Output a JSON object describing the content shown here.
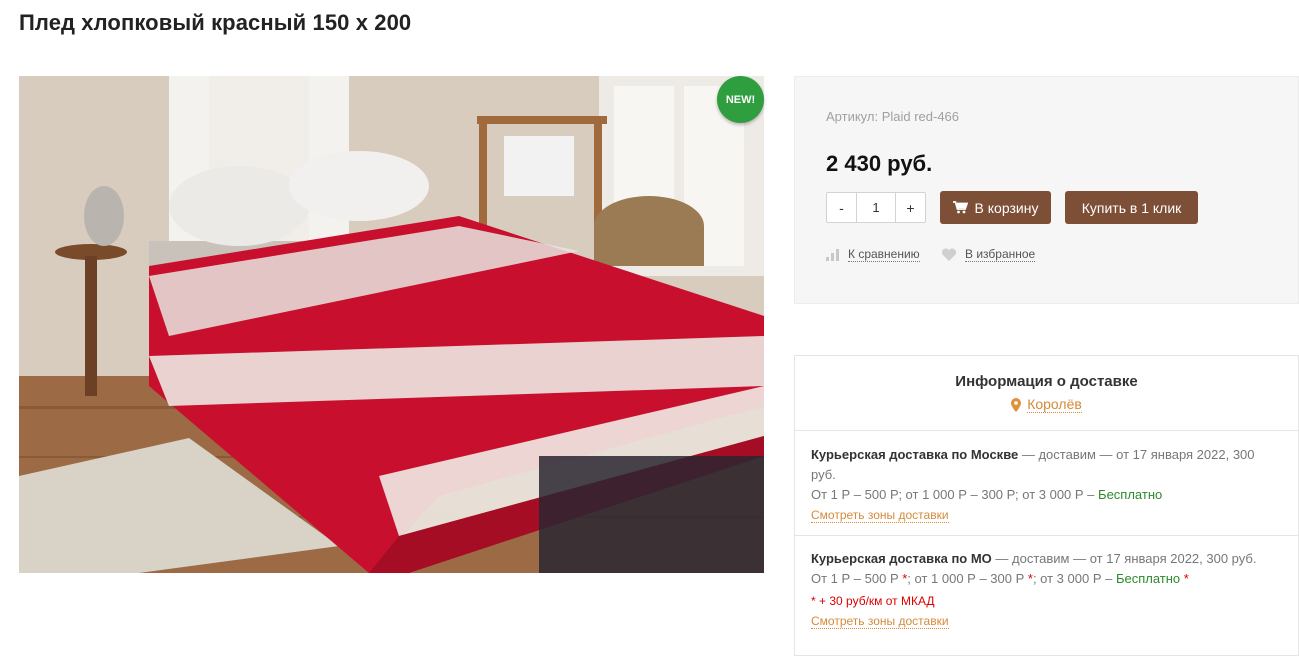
{
  "page": {
    "title": "Плед хлопковый красный 150 х 200"
  },
  "product": {
    "badge": "NEW!",
    "article": "Артикул: Plaid red-466",
    "price": "2 430 руб.",
    "quantity": "1",
    "qty_minus": "-",
    "qty_plus": "+",
    "cart_button": "В корзину",
    "one_click_button": "Купить в 1 клик",
    "compare_label": "К сравнению",
    "favorite_label": "В избранное"
  },
  "delivery": {
    "title": "Информация о доставке",
    "city": "Королёв",
    "courier_moscow": {
      "name": "Курьерская доставка по Москве",
      "terms": " — доставим — от 17 января 2022, 300 руб.",
      "prices": "От 1 Р – 500 Р; от 1 000 Р – 300 Р; от 3 000 Р – ",
      "free": "Бесплатно",
      "zones_link": "Смотреть зоны доставки"
    },
    "courier_mo": {
      "name": "Курьерская доставка по МО",
      "terms": "  — доставим — от 17 января 2022, 300 руб.",
      "price1": "От 1 Р – 500 Р",
      "price2": "; от 1 000 Р – 300 Р",
      "price3": "; от 3 000 Р – ",
      "free": "Бесплатно",
      "star": " *",
      "mkad_note": "*  + 30 руб/км от МКАД",
      "zones_link": "Смотреть зоны доставки"
    }
  },
  "colors": {
    "accent_button": "#7d4f36",
    "badge": "#2e9e3e",
    "link_orange": "#d48a3a",
    "free_green": "#2c8a2c"
  }
}
